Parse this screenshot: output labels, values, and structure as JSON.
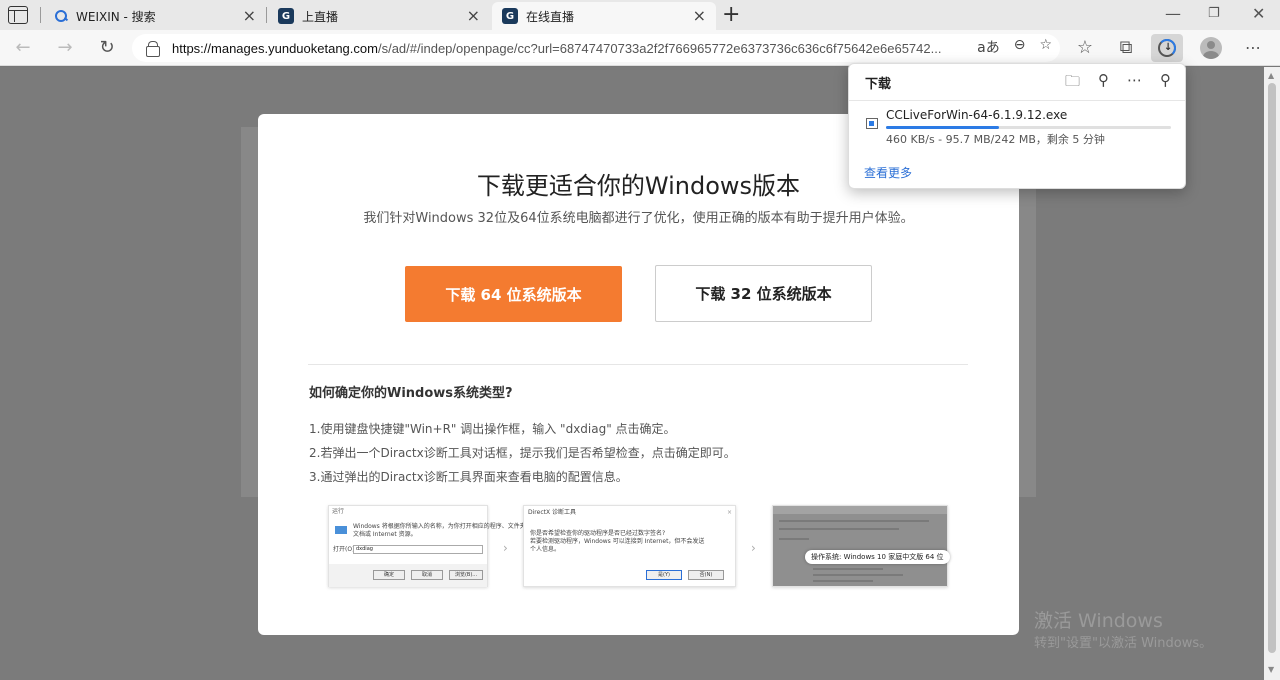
{
  "tabs": [
    {
      "title": "WEIXIN - 搜索",
      "favicon": "search-icon"
    },
    {
      "title": "上直播",
      "favicon": "live-logo-icon"
    },
    {
      "title": "在线直播",
      "favicon": "live-logo-icon",
      "active": true
    }
  ],
  "window_controls": {
    "minimize": "—",
    "restore": "❐",
    "close": "✕"
  },
  "address": {
    "url_host": "https://manages.yunduoketang.com",
    "url_rest": "/s/ad/#/indep/openpage/cc?url=68747470733a2f2f766965772e6373736c636c6f75642e6e65742...",
    "read_aloud": "aあ"
  },
  "modal": {
    "title": "下载更适合你的Windows版本",
    "subtitle": "我们针对Windows 32位及64位系统电脑都进行了优化，使用正确的版本有助于提升用户体验。",
    "btn_64": "下载 64 位系统版本",
    "btn_32": "下载 32 位系统版本",
    "help_title": "如何确定你的Windows系统类型?",
    "steps": [
      "1.使用键盘快捷键\"Win+R\" 调出操作框，输入 \"dxdiag\" 点击确定。",
      "2.若弹出一个Diractx诊断工具对话框，提示我们是否希望检查，点击确定即可。",
      "3.通过弹出的Diractx诊断工具界面来查看电脑的配置信息。"
    ],
    "thumbs": {
      "run_title": "运行",
      "run_text_1": "Windows 将根据你所输入的名称，为你打开相应的程序、文件夹、",
      "run_text_2": "文档或 Internet 资源。",
      "run_label": "打开(O):",
      "run_value": "dxdiag",
      "run_ok": "确定",
      "run_cancel": "取消",
      "run_browse": "浏览(B)...",
      "dx_title": "DirectX 诊断工具",
      "dx_text_1": "你是否希望检查你的驱动程序是否已经过数字签名?",
      "dx_text_2": "若要检测驱动程序，Windows 可以连接到 Internet，但不会发送",
      "dx_text_3": "个人信息。",
      "dx_yes": "是(Y)",
      "dx_no": "否(N)",
      "sys_badge": "操作系统: Windows 10 家庭中文版 64 位"
    }
  },
  "downloads": {
    "title": "下载",
    "filename": "CCLiveForWin-64-6.1.9.12.exe",
    "status": "460 KB/s - 95.7 MB/242 MB，剩余 5 分钟",
    "progress": 0.395,
    "see_more": "查看更多"
  },
  "watermark": {
    "line1": "激活 Windows",
    "line2": "转到\"设置\"以激活 Windows。"
  },
  "colors": {
    "accent_orange": "#f47b30",
    "link_blue": "#2b6fd6",
    "progress_blue": "#2c7be5"
  }
}
